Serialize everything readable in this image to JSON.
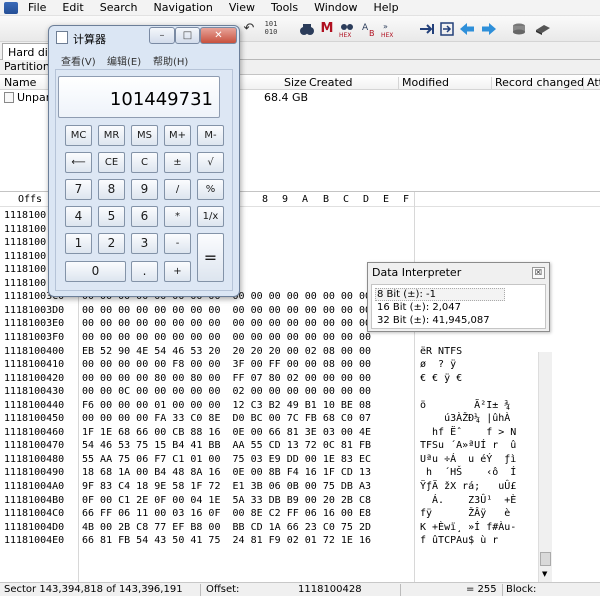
{
  "menu": [
    "File",
    "Edit",
    "Search",
    "Navigation",
    "View",
    "Tools",
    "Window",
    "Help"
  ],
  "toolbar": {
    "icons": [
      "new-file-icon",
      "save-icon",
      "open-disk-icon",
      "print-icon",
      "properties-icon",
      "undo-icon",
      "copy-icon",
      "paste-icon",
      "fill-block-icon",
      "hex-conversion-icon",
      "find-icon",
      "find-text-icon",
      "find-hex-icon",
      "replace-icon",
      "replace-hex-icon",
      "goto-offset-icon",
      "goto-sector-icon",
      "back-icon",
      "forward-icon",
      "disk-editor-icon",
      "ram-editor-icon"
    ],
    "hex_label": "HEX",
    "bits_label": "101\n010"
  },
  "doc_tab": "Hard dis",
  "partitioning": "Partitioni",
  "file_list": {
    "columns": [
      "Name",
      "Size",
      "Created",
      "Modified",
      "Record changed",
      "Att"
    ],
    "row": {
      "name": "Unpar",
      "size": "68.4 GB"
    }
  },
  "hex": {
    "header_offset": "Offs",
    "header_cols": [
      "8",
      "9",
      "A",
      "B",
      "C",
      "D",
      "E",
      "F"
    ],
    "rows": [
      {
        "offset": "1118100",
        "bytes": "",
        "text": ""
      },
      {
        "offset": "1118100",
        "bytes": "",
        "text": ""
      },
      {
        "offset": "1118100",
        "bytes": "",
        "text": ""
      },
      {
        "offset": "1118100",
        "bytes": "",
        "text": ""
      },
      {
        "offset": "1118100",
        "bytes": "",
        "text": ""
      },
      {
        "offset": "1118100",
        "bytes": "",
        "text": ""
      },
      {
        "offset": "11181003C0",
        "bytes": "00 00 00 00 00 00 00 00  00 00 00 00 00 00 00 00",
        "text": ""
      },
      {
        "offset": "11181003D0",
        "bytes": "00 00 00 00 00 00 00 00  00 00 00 00 00 00 00 00",
        "text": ""
      },
      {
        "offset": "11181003E0",
        "bytes": "00 00 00 00 00 00 00 00  00 00 00 00 00 00 00 00",
        "text": ""
      },
      {
        "offset": "11181003F0",
        "bytes": "00 00 00 00 00 00 00 00  00 00 00 00 00 00 00 00",
        "text": ""
      },
      {
        "offset": "1118100400",
        "bytes": "EB 52 90 4E 54 46 53 20  20 20 20 00 02 08 00 00",
        "text": "ëR NTFS"
      },
      {
        "offset": "1118100410",
        "bytes": "00 00 00 00 00 F8 00 00  3F 00 FF 00 00 08 00 00",
        "text": "ø  ? ÿ"
      },
      {
        "offset": "1118100420",
        "bytes": "00 00 00 00 80 00 80 00  FF 07 80 02 00 00 00 00",
        "text": "€ € ÿ €"
      },
      {
        "offset": "1118100430",
        "bytes": "00 00 0C 00 00 00 00 00  02 00 00 00 00 00 00 00",
        "text": ""
      },
      {
        "offset": "1118100440",
        "bytes": "F6 00 00 00 01 00 00 00  12 C3 B2 49 B1 10 BE 08",
        "text": "ö        Ã²I± ¾"
      },
      {
        "offset": "1118100450",
        "bytes": "00 00 00 00 FA 33 C0 8E  D0 BC 00 7C FB 68 C0 07",
        "text": "    ú3ÀŽÐ¼ |ûhÀ"
      },
      {
        "offset": "1118100460",
        "bytes": "1F 1E 68 66 00 CB 88 16  0E 00 66 81 3E 03 00 4E",
        "text": "  hf Ëˆ    f > N"
      },
      {
        "offset": "1118100470",
        "bytes": "54 46 53 75 15 B4 41 BB  AA 55 CD 13 72 0C 81 FB",
        "text": "TFSu ´A»ªUÍ r  û"
      },
      {
        "offset": "1118100480",
        "bytes": "55 AA 75 06 F7 C1 01 00  75 03 E9 DD 00 1E 83 EC",
        "text": "Uªu ÷Á  u éÝ  ƒì"
      },
      {
        "offset": "1118100490",
        "bytes": "18 68 1A 00 B4 48 8A 16  0E 00 8B F4 16 1F CD 13",
        "text": " h  ´HŠ    ‹ô  Í"
      },
      {
        "offset": "11181004A0",
        "bytes": "9F 83 C4 18 9E 58 1F 72  E1 3B 06 0B 00 75 DB A3",
        "text": "ŸƒÄ žX rá;   uÛ£"
      },
      {
        "offset": "11181004B0",
        "bytes": "0F 00 C1 2E 0F 00 04 1E  5A 33 DB B9 00 20 2B C8",
        "text": "  Á.    Z3Û¹  +È"
      },
      {
        "offset": "11181004C0",
        "bytes": "66 FF 06 11 00 03 16 0F  00 8E C2 FF 06 16 00 E8",
        "text": "fÿ      ŽÂÿ   è"
      },
      {
        "offset": "11181004D0",
        "bytes": "4B 00 2B C8 77 EF B8 00  BB CD 1A 66 23 C0 75 2D",
        "text": "K +Èwï¸ »Í f#Àu-"
      },
      {
        "offset": "11181004E0",
        "bytes": "66 81 FB 54 43 50 41 75  24 81 F9 02 01 72 1E 16",
        "text": "f ûTCPAu$ ù r"
      }
    ]
  },
  "calculator": {
    "title": "计算器",
    "menu": [
      "查看(V)",
      "编辑(E)",
      "帮助(H)"
    ],
    "display": "101449731",
    "window_buttons": {
      "minimize": "–",
      "maximize": "□",
      "close": "✕"
    },
    "buttons": {
      "mc": "MC",
      "mr": "MR",
      "ms": "MS",
      "mplus": "M+",
      "mminus": "M-",
      "back": "⟵",
      "ce": "CE",
      "c": "C",
      "plusminus": "±",
      "sqrt": "√",
      "n7": "7",
      "n8": "8",
      "n9": "9",
      "div": "/",
      "pct": "%",
      "n4": "4",
      "n5": "5",
      "n6": "6",
      "mul": "*",
      "recip": "1/x",
      "n1": "1",
      "n2": "2",
      "n3": "3",
      "sub": "-",
      "eq": "=",
      "n0": "0",
      "dot": ".",
      "add": "+"
    }
  },
  "data_interpreter": {
    "title": "Data Interpreter",
    "close": "☒",
    "rows": [
      "8 Bit (±): -1",
      "16 Bit (±): 2,047",
      "32 Bit (±): 41,945,087"
    ]
  },
  "status": {
    "sector": "Sector 143,394,818 of 143,396,191",
    "offset_label": "Offset:",
    "offset_value": "1118100428",
    "value": "= 255",
    "block": "Block:"
  }
}
